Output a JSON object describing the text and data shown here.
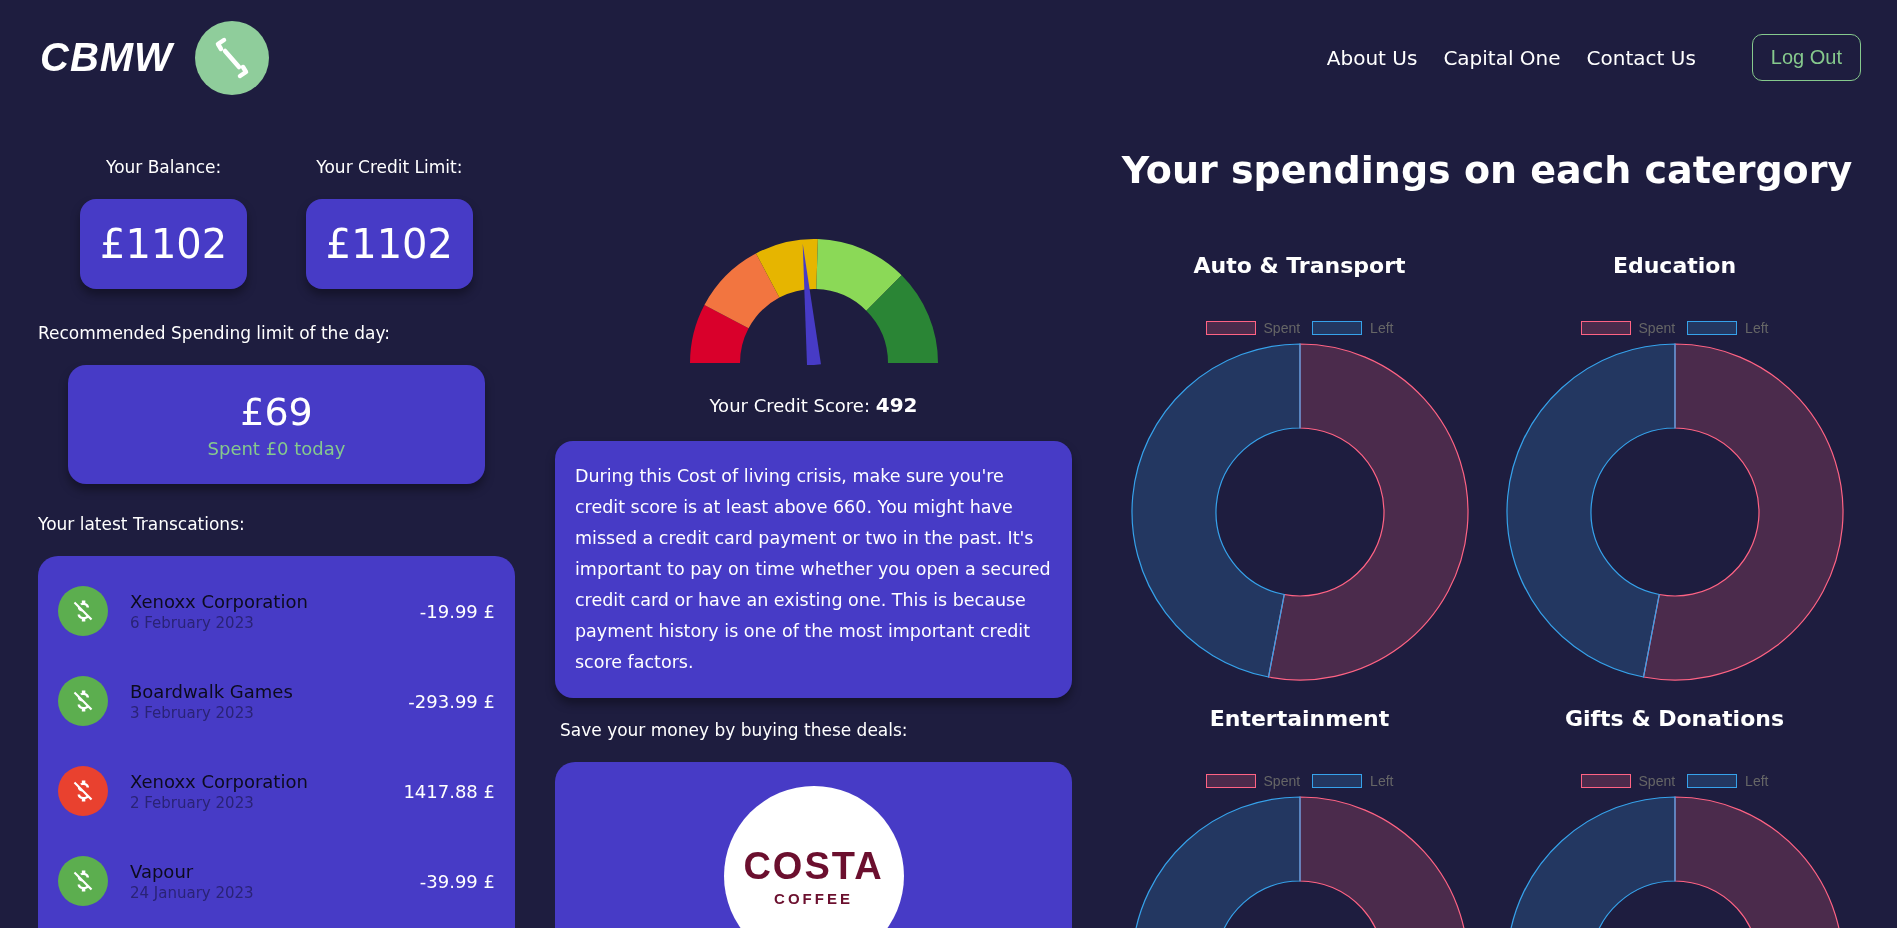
{
  "header": {
    "logo_text": "CBMW",
    "nav": [
      "About Us",
      "Capital One",
      "Contact Us"
    ],
    "logout": "Log Out"
  },
  "summary": [
    {
      "label": "Your Balance:",
      "value": "£1102"
    },
    {
      "label": "Your Credit Limit:",
      "value": "£1102"
    }
  ],
  "daily_limit": {
    "label": "Recommended Spending limit of the day:",
    "value": "£69",
    "spent": "Spent £0 today"
  },
  "transactions": {
    "label": "Your latest Transcations:",
    "items": [
      {
        "name": "Xenoxx Corporation",
        "date": "6 February 2023",
        "amount": "-19.99 £",
        "color": "#5cae4f"
      },
      {
        "name": "Boardwalk Games",
        "date": "3 February 2023",
        "amount": "-293.99 £",
        "color": "#5cae4f"
      },
      {
        "name": "Xenoxx Corporation",
        "date": "2 February 2023",
        "amount": "1417.88 £",
        "color": "#e9412f"
      },
      {
        "name": "Vapour",
        "date": "24 January 2023",
        "amount": "-39.99 £",
        "color": "#5cae4f"
      }
    ]
  },
  "credit_score": {
    "label": "Your Credit Score:",
    "value": "492",
    "level": 0.47
  },
  "tip": "During this Cost of living crisis, make sure you're credit score is at least above 660. You might have missed a credit card payment or two in the past. It's important to pay on time whether you open a secured credit card or have an existing one. This is because payment history is one of the most important credit score factors.",
  "deals": {
    "label": "Save your money by buying these deals:",
    "items": [
      {
        "brand": "COSTA",
        "subtitle": "COFFEE"
      }
    ]
  },
  "spendings": {
    "title": "Your spendings on each catergory",
    "categories": [
      {
        "title": "Auto & Transport",
        "legend": [
          {
            "label": "Spent",
            "color": "#ff6384"
          },
          {
            "label": "Left",
            "color": "#36a2eb"
          }
        ]
      },
      {
        "title": "Education",
        "legend": [
          {
            "label": "Spent",
            "color": "#ff6384"
          },
          {
            "label": "Left",
            "color": "#36a2eb"
          }
        ]
      },
      {
        "title": "Entertainment",
        "legend": [
          {
            "label": "Spent",
            "color": "#ff6384"
          },
          {
            "label": "Left",
            "color": "#36a2eb"
          }
        ]
      },
      {
        "title": "Gifts & Donations",
        "legend": [
          {
            "label": "Spent",
            "color": "#ff6384"
          },
          {
            "label": "Left",
            "color": "#36a2eb"
          }
        ]
      }
    ]
  }
}
